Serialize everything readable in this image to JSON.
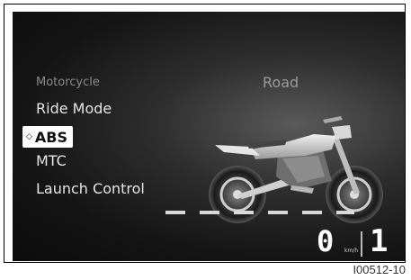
{
  "menu": {
    "header": "Motorcycle",
    "items": [
      {
        "label": "Ride Mode"
      },
      {
        "label": "ABS",
        "selected": true
      },
      {
        "label": "MTC"
      },
      {
        "label": "Launch Control"
      }
    ]
  },
  "ride_mode_value": "Road",
  "speed": {
    "value": "0",
    "unit": "km/h"
  },
  "gear": "1",
  "image_reference": "I00512-10",
  "colors": {
    "screen_bg": "#141414",
    "selection": "#ffffff",
    "text": "#e6e6e6"
  }
}
